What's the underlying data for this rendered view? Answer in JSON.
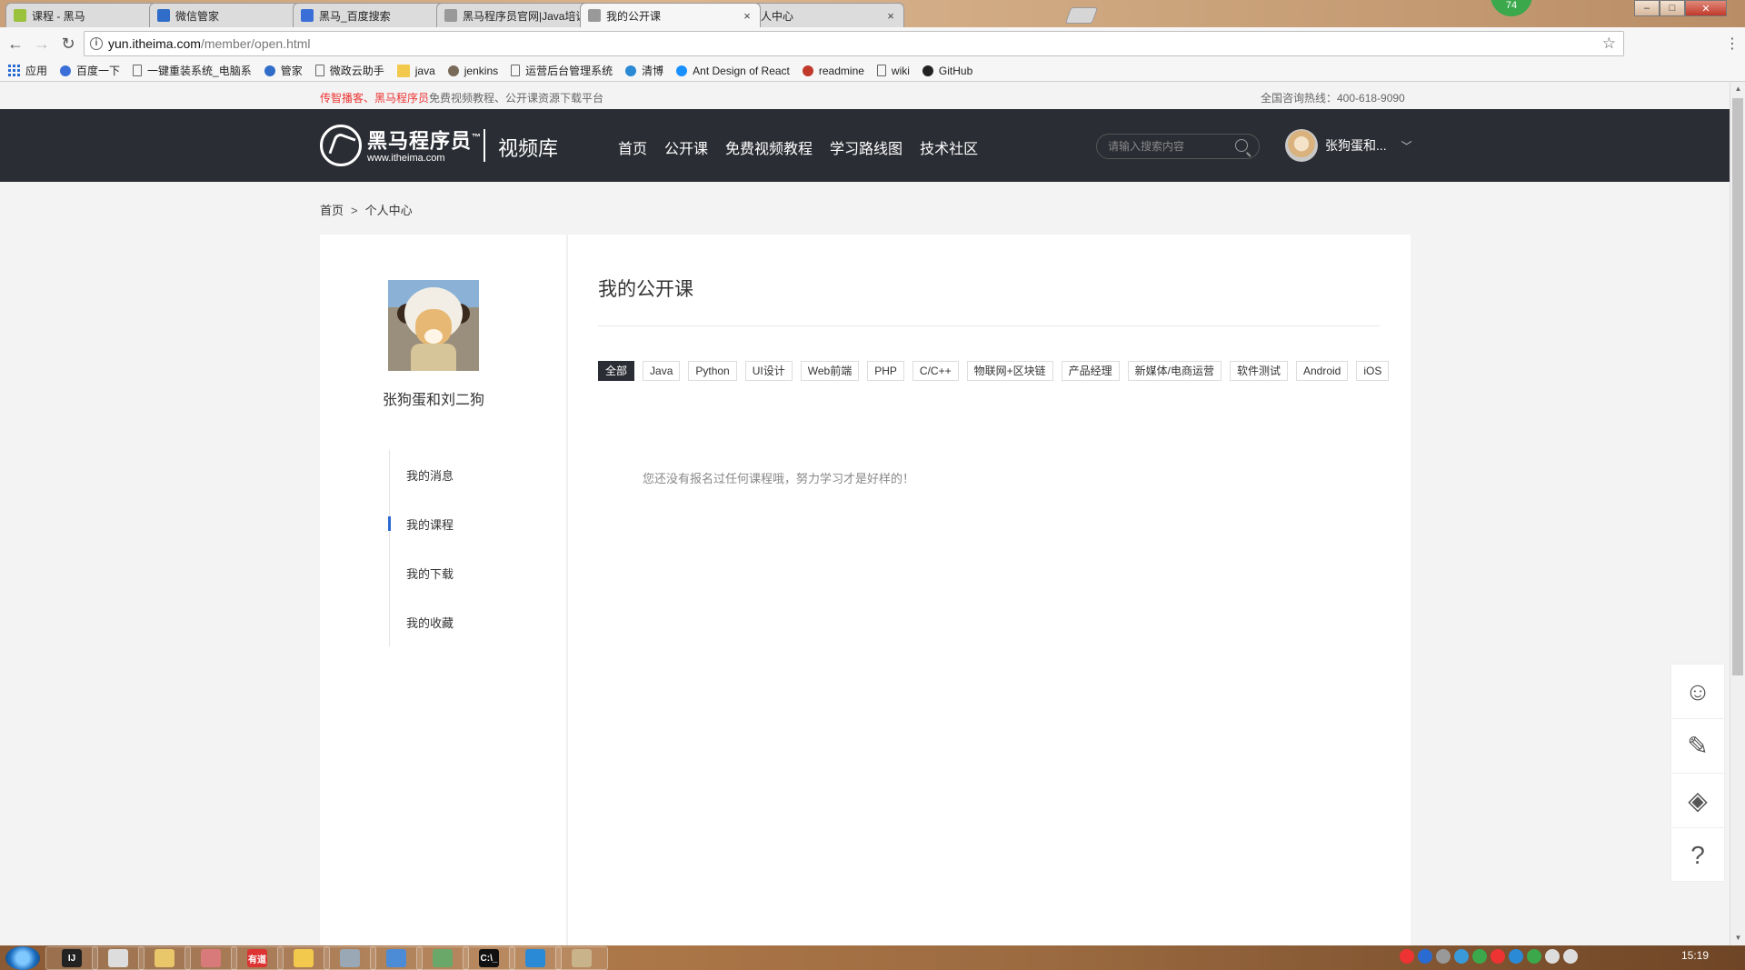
{
  "browser": {
    "tabs": [
      {
        "title": "课程 - 黑马",
        "favicon_color": "#9bc23c",
        "active": false
      },
      {
        "title": "微信管家",
        "favicon_color": "#2f6dc9",
        "active": false
      },
      {
        "title": "黑马_百度搜索",
        "favicon_color": "#3b6fd8",
        "active": false
      },
      {
        "title": "黑马程序员官网|Java培训",
        "favicon_color": "#999999",
        "active": false
      },
      {
        "title": "我的公开课",
        "favicon_color": "#999999",
        "active": true
      },
      {
        "title": "个人中心",
        "favicon_color": "#999999",
        "active": false
      }
    ],
    "badge": "74",
    "url_host": "yun.itheima.com",
    "url_path": "/member/open.html",
    "bookmarks": [
      {
        "label": "应用",
        "icon": "apps-icon"
      },
      {
        "label": "百度一下",
        "icon": "baidu-icon"
      },
      {
        "label": "一键重装系统_电脑系",
        "icon": "page-icon"
      },
      {
        "label": "管家",
        "icon": "wechat-manager-icon"
      },
      {
        "label": "微政云助手",
        "icon": "page-icon"
      },
      {
        "label": "java",
        "icon": "folder-icon"
      },
      {
        "label": "jenkins",
        "icon": "jenkins-icon"
      },
      {
        "label": "运营后台管理系统",
        "icon": "page-icon"
      },
      {
        "label": "清博",
        "icon": "qingbo-icon"
      },
      {
        "label": "Ant Design of React",
        "icon": "antd-icon"
      },
      {
        "label": "readmine",
        "icon": "redmine-icon"
      },
      {
        "label": "wiki",
        "icon": "page-icon"
      },
      {
        "label": "GitHub",
        "icon": "github-icon"
      }
    ]
  },
  "topstrip": {
    "left_red": "传智播客、黑马程序员",
    "left_rest": "免费视频教程、公开课资源下载平台",
    "hotline": "全国咨询热线：400-618-9090"
  },
  "header": {
    "logo_cn": "黑马程序员",
    "logo_tm": "™",
    "logo_en": "www.itheima.com",
    "logo_sub": "视频库",
    "nav": [
      "首页",
      "公开课",
      "免费视频教程",
      "学习路线图",
      "技术社区"
    ],
    "search_placeholder": "请输入搜索内容",
    "username": "张狗蛋和..."
  },
  "breadcrumb": {
    "home": "首页",
    "sep": ">",
    "current": "个人中心"
  },
  "profile": {
    "name": "张狗蛋和刘二狗"
  },
  "sidemenu": [
    {
      "label": "我的消息",
      "active": false
    },
    {
      "label": "我的课程",
      "active": true
    },
    {
      "label": "我的下载",
      "active": false
    },
    {
      "label": "我的收藏",
      "active": false
    }
  ],
  "content": {
    "title": "我的公开课",
    "filters": [
      "全部",
      "Java",
      "Python",
      "UI设计",
      "Web前端",
      "PHP",
      "C/C++",
      "物联网+区块链",
      "产品经理",
      "新媒体/电商运营",
      "软件测试",
      "Android",
      "iOS"
    ],
    "active_filter": "全部",
    "empty_message": "您还没有报名过任何课程哦，努力学习才是好样的！"
  },
  "floatbar": [
    {
      "icon": "customer-service-icon",
      "glyph": "☺"
    },
    {
      "icon": "feedback-pen-icon",
      "glyph": "✎"
    },
    {
      "icon": "layers-icon",
      "glyph": "◈"
    },
    {
      "icon": "help-icon",
      "glyph": "?"
    }
  ],
  "taskbar": {
    "apps": [
      {
        "label": "IJ",
        "icon": "intellij-icon",
        "color": "#222222"
      },
      {
        "label": "",
        "icon": "chrome-icon",
        "color": "#dddddd"
      },
      {
        "label": "",
        "icon": "explorer-icon",
        "color": "#e8c66a"
      },
      {
        "label": "",
        "icon": "app-icon",
        "color": "#d97a7a"
      },
      {
        "label": "有道",
        "icon": "youdao-icon",
        "color": "#d33"
      },
      {
        "label": "",
        "icon": "mascot-icon",
        "color": "#f2c94c"
      },
      {
        "label": "",
        "icon": "window-icon",
        "color": "#9aa7b5"
      },
      {
        "label": "",
        "icon": "ide-icon",
        "color": "#4c8bd6"
      },
      {
        "label": "",
        "icon": "notebook-icon",
        "color": "#6aa86a"
      },
      {
        "label": "C:\\_",
        "icon": "cmd-icon",
        "color": "#111111"
      },
      {
        "label": "",
        "icon": "feiq-icon",
        "color": "#2a8ad6"
      },
      {
        "label": "",
        "icon": "dog-icon",
        "color": "#c9b38a"
      }
    ],
    "time": "15:19"
  }
}
